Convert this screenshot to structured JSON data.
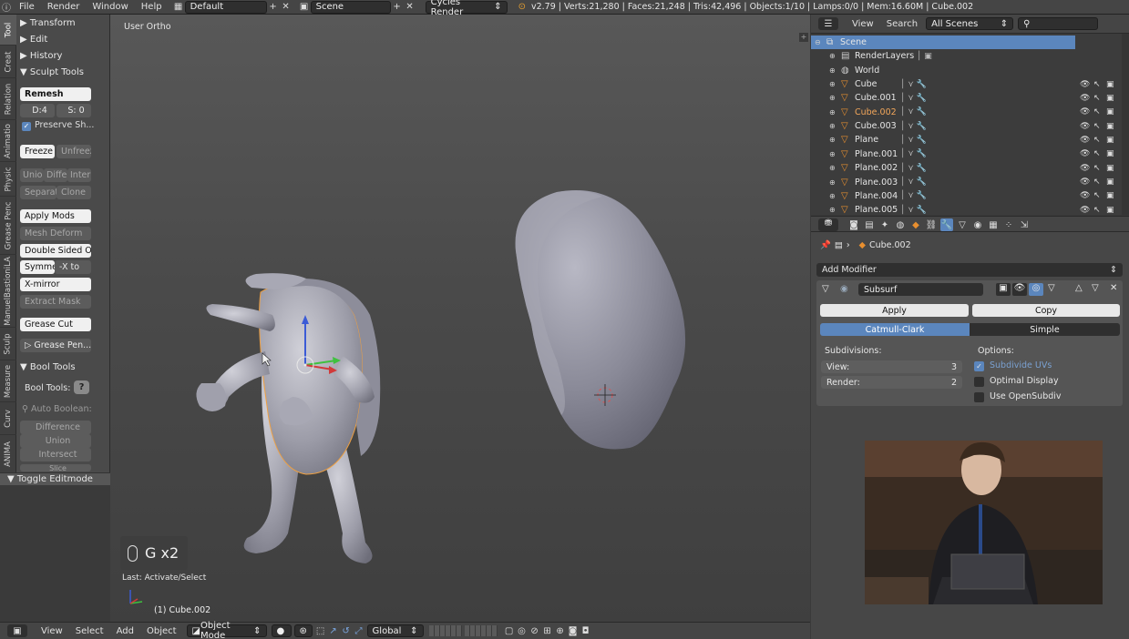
{
  "topbar": {
    "menus": [
      "File",
      "Render",
      "Window",
      "Help"
    ],
    "layout": "Default",
    "scene": "Scene",
    "engine": "Cycles Render",
    "stats": "v2.79 | Verts:21,280 | Faces:21,248 | Tris:42,496 | Objects:1/10 | Lamps:0/0 | Mem:16.60M | Cube.002"
  },
  "tabs": [
    "Tool",
    "Creat",
    "Relation",
    "Animatio",
    "Physic",
    "Grease Penc",
    "ManuelBastioniLA",
    "Sculp",
    "Measure",
    "Curv",
    "ANIMA"
  ],
  "toolshelf": {
    "transform": "Transform",
    "edit": "Edit",
    "history": "History",
    "sculpt_tools": "Sculpt Tools",
    "remesh": "Remesh",
    "depth": "D:4",
    "sharpness": "S: 0",
    "preserve": "Preserve Sh...",
    "freeze": "Freeze",
    "unfreeze": "Unfreez",
    "union": "Unio",
    "difference": "Diffe",
    "intersect": "Inter",
    "separate": "Separat",
    "clone": "Clone",
    "apply_mods": "Apply Mods",
    "mesh_deform": "Mesh Deform",
    "double_sided": "Double Sided Off",
    "symmetry": "Symme",
    "symmetry_axis": "-X to",
    "xmirror": "X-mirror",
    "extract_mask": "Extract Mask",
    "grease_cut": "Grease Cut",
    "grease_pen": "Grease Pen...",
    "bool_tools_header": "Bool Tools",
    "bool_tools_label": "Bool Tools:",
    "auto_boolean": "Auto Boolean:",
    "bool_difference": "Difference",
    "bool_union": "Union",
    "bool_intersect": "Intersect",
    "bool_slice": "Slice",
    "toggle_editmode": "Toggle Editmode"
  },
  "viewport": {
    "view_label": "User Ortho",
    "key_display": "G x2",
    "last_op": "Last: Activate/Select",
    "active_object": "(1) Cube.002"
  },
  "vp_header": {
    "menus": [
      "View",
      "Select",
      "Add",
      "Object"
    ],
    "mode": "Object Mode",
    "orientation": "Global"
  },
  "outliner": {
    "menus": [
      "View",
      "Search"
    ],
    "filter": "All Scenes",
    "rows": [
      {
        "name": "Scene",
        "type": "scene"
      },
      {
        "name": "RenderLayers",
        "type": "renderlayers"
      },
      {
        "name": "World",
        "type": "world"
      },
      {
        "name": "Cube",
        "type": "mesh"
      },
      {
        "name": "Cube.001",
        "type": "mesh"
      },
      {
        "name": "Cube.002",
        "type": "mesh"
      },
      {
        "name": "Cube.003",
        "type": "mesh"
      },
      {
        "name": "Plane",
        "type": "mesh"
      },
      {
        "name": "Plane.001",
        "type": "mesh"
      },
      {
        "name": "Plane.002",
        "type": "mesh"
      },
      {
        "name": "Plane.003",
        "type": "mesh"
      },
      {
        "name": "Plane.004",
        "type": "mesh"
      },
      {
        "name": "Plane.005",
        "type": "mesh"
      }
    ]
  },
  "properties": {
    "breadcrumb_object": "Cube.002",
    "add_modifier": "Add Modifier",
    "modifier_name": "Subsurf",
    "apply": "Apply",
    "copy": "Copy",
    "catmull_clark": "Catmull-Clark",
    "simple": "Simple",
    "subdivisions_label": "Subdivisions:",
    "view_label": "View:",
    "view_value": "3",
    "render_label": "Render:",
    "render_value": "2",
    "options_label": "Options:",
    "subdivide_uvs": "Subdivide UVs",
    "optimal_display": "Optimal Display",
    "use_opensubdiv": "Use OpenSubdiv"
  },
  "colors": {
    "selection": "#5b86bd",
    "active_object_text": "#f2a65a",
    "mesh_icon": "#e88f2f"
  }
}
